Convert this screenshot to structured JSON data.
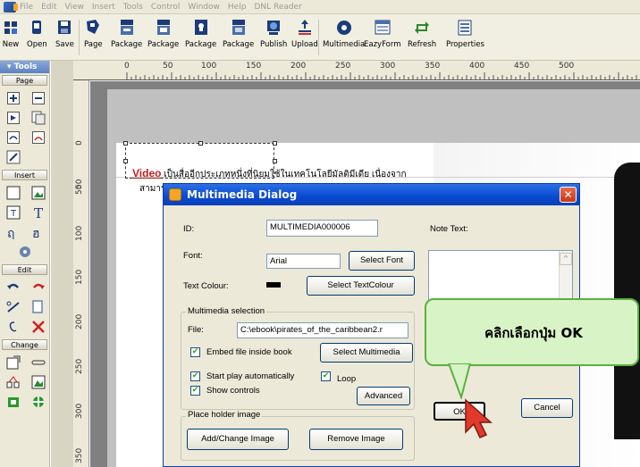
{
  "menu": [
    "File",
    "Edit",
    "View",
    "Insert",
    "Tools",
    "Control",
    "Window",
    "Help",
    "DNL Reader"
  ],
  "toolbar": {
    "buttons": [
      "New",
      "Open",
      "Save",
      "Page",
      "Package",
      "Package",
      "Package",
      "Package",
      "Publish",
      "Upload",
      "Multimedia",
      "EazyForm",
      "Refresh",
      "Properties"
    ]
  },
  "tools_panel": {
    "title": "▾ Tools",
    "sections": [
      "Page",
      "Insert",
      "Edit",
      "Change"
    ]
  },
  "rulers": {
    "top": [
      "0",
      "50",
      "100",
      "150",
      "200",
      "250",
      "300",
      "350",
      "400",
      "450",
      "500"
    ],
    "left": [
      "50",
      "0",
      "50",
      "100",
      "150",
      "200",
      "250",
      "300",
      "350"
    ]
  },
  "page_text": {
    "line1_bold": "Video",
    "line1_rest": " เป็นสื่ออีกประเภทหนึ่งที่นิยมใช้ในเทคโนโลยีมัลติมีเดีย เนื่องจาก",
    "line2": "สามารถ"
  },
  "dialog": {
    "title": "Multimedia Dialog",
    "close": "✕",
    "id_label": "ID:",
    "id_value": "MULTIMEDIA000006",
    "note_label": "Note Text:",
    "font_label": "Font:",
    "font_value": "Arial",
    "select_font": "Select Font",
    "text_colour_label": "Text Colour:",
    "select_text_colour": "Select TextColour",
    "multimedia_group": "Multimedia selection",
    "file_label": "File:",
    "file_value": "C:\\ebook\\pirates_of_the_caribbean2.r",
    "embed_label": "Embed file inside book",
    "select_multimedia": "Select Multimedia",
    "start_auto_label": "Start play automatically",
    "loop_label": "Loop",
    "show_controls_label": "Show controls",
    "advanced": "Advanced",
    "placeholder_group": "Place holder image",
    "add_change_image": "Add/Change Image",
    "remove_image": "Remove Image",
    "ok": "OK",
    "cancel": "Cancel"
  },
  "callout": {
    "text": "คลิกเลือกปุ่ม OK"
  },
  "colors": {
    "title_bar": "#0a4ad0",
    "callout_bg": "#d8f3c6",
    "callout_border": "#5cb040",
    "cursor": "#e23a2a"
  }
}
